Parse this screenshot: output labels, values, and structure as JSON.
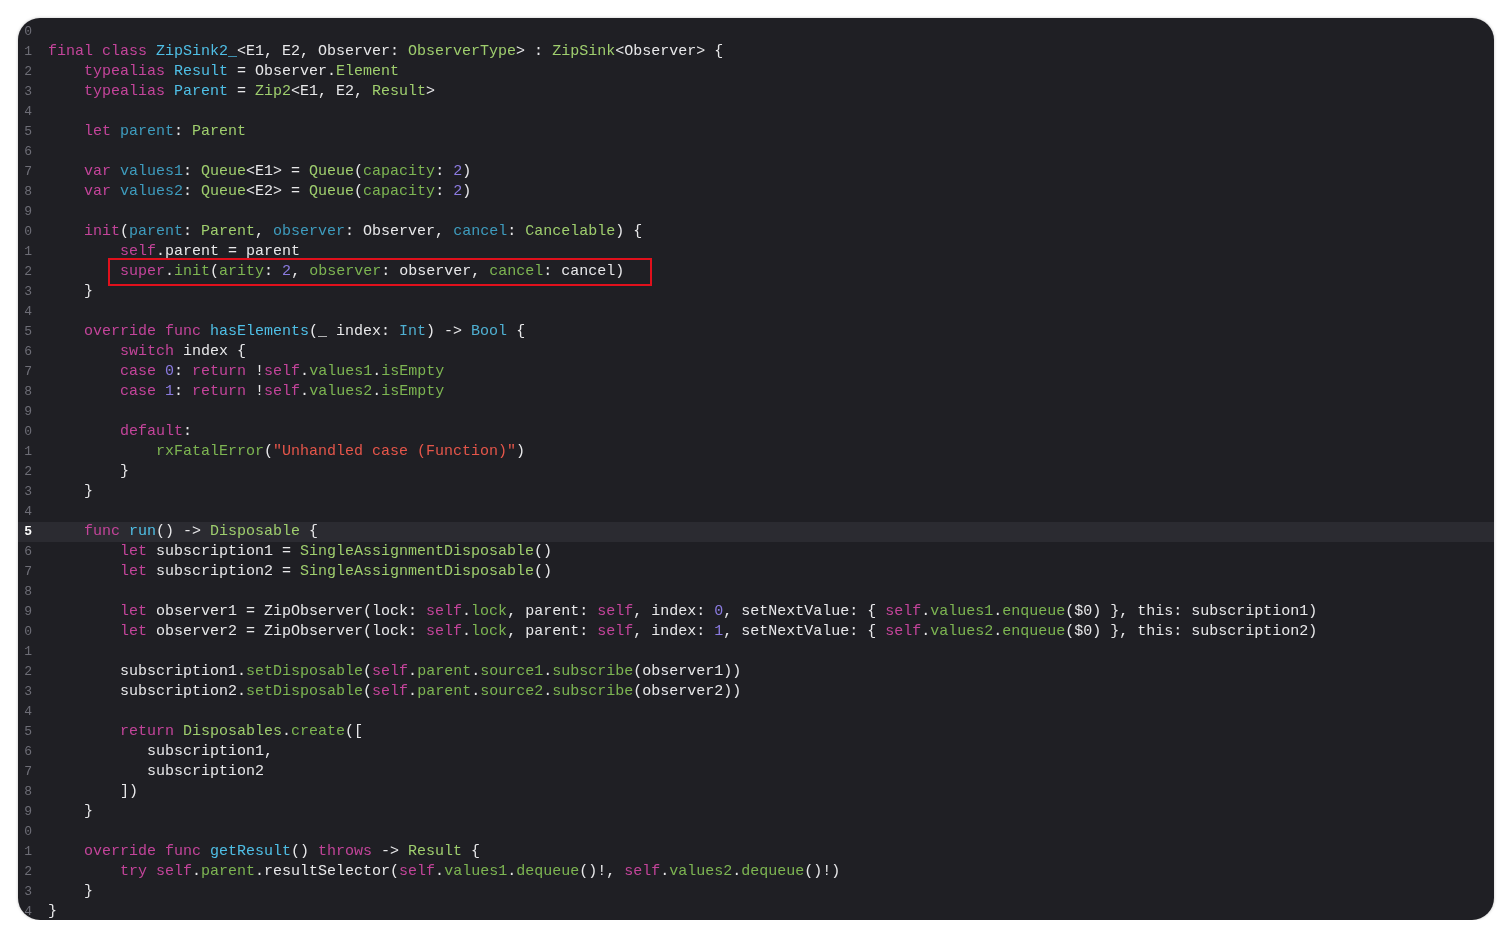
{
  "editor": {
    "lines": [
      {
        "n": "0",
        "current": false,
        "boxed": false
      },
      {
        "n": "1",
        "current": false,
        "boxed": false,
        "tokens": [
          {
            "kind": "kw",
            "text": "final class "
          },
          {
            "kind": "decl",
            "text": "ZipSink2_"
          },
          {
            "kind": "plain",
            "text": "<E1, E2, Observer: "
          },
          {
            "kind": "type",
            "text": "ObserverType"
          },
          {
            "kind": "plain",
            "text": "> : "
          },
          {
            "kind": "type",
            "text": "ZipSink"
          },
          {
            "kind": "plain",
            "text": "<Observer> {"
          }
        ]
      },
      {
        "n": "2",
        "current": false,
        "boxed": false,
        "tokens": [
          {
            "kind": "kw",
            "text": "    typealias "
          },
          {
            "kind": "decl",
            "text": "Result"
          },
          {
            "kind": "plain",
            "text": " = Observer."
          },
          {
            "kind": "type",
            "text": "Element"
          }
        ]
      },
      {
        "n": "3",
        "current": false,
        "boxed": false,
        "tokens": [
          {
            "kind": "kw",
            "text": "    typealias "
          },
          {
            "kind": "decl",
            "text": "Parent"
          },
          {
            "kind": "plain",
            "text": " = "
          },
          {
            "kind": "type",
            "text": "Zip2"
          },
          {
            "kind": "plain",
            "text": "<E1, E2, "
          },
          {
            "kind": "type",
            "text": "Result"
          },
          {
            "kind": "plain",
            "text": ">"
          }
        ]
      },
      {
        "n": "4",
        "current": false,
        "boxed": false
      },
      {
        "n": "5",
        "current": false,
        "boxed": false,
        "tokens": [
          {
            "kind": "kw",
            "text": "    let "
          },
          {
            "kind": "prop",
            "text": "parent"
          },
          {
            "kind": "plain",
            "text": ": "
          },
          {
            "kind": "type",
            "text": "Parent"
          }
        ]
      },
      {
        "n": "6",
        "current": false,
        "boxed": false
      },
      {
        "n": "7",
        "current": false,
        "boxed": false,
        "tokens": [
          {
            "kind": "kw",
            "text": "    var "
          },
          {
            "kind": "prop",
            "text": "values1"
          },
          {
            "kind": "plain",
            "text": ": "
          },
          {
            "kind": "type",
            "text": "Queue"
          },
          {
            "kind": "plain",
            "text": "<E1> = "
          },
          {
            "kind": "type",
            "text": "Queue"
          },
          {
            "kind": "plain",
            "text": "("
          },
          {
            "kind": "member",
            "text": "capacity"
          },
          {
            "kind": "plain",
            "text": ": "
          },
          {
            "kind": "num",
            "text": "2"
          },
          {
            "kind": "plain",
            "text": ")"
          }
        ]
      },
      {
        "n": "8",
        "current": false,
        "boxed": false,
        "tokens": [
          {
            "kind": "kw",
            "text": "    var "
          },
          {
            "kind": "prop",
            "text": "values2"
          },
          {
            "kind": "plain",
            "text": ": "
          },
          {
            "kind": "type",
            "text": "Queue"
          },
          {
            "kind": "plain",
            "text": "<E2> = "
          },
          {
            "kind": "type",
            "text": "Queue"
          },
          {
            "kind": "plain",
            "text": "("
          },
          {
            "kind": "member",
            "text": "capacity"
          },
          {
            "kind": "plain",
            "text": ": "
          },
          {
            "kind": "num",
            "text": "2"
          },
          {
            "kind": "plain",
            "text": ")"
          }
        ]
      },
      {
        "n": "9",
        "current": false,
        "boxed": false
      },
      {
        "n": "0",
        "current": false,
        "boxed": false,
        "tokens": [
          {
            "kind": "kw",
            "text": "    init"
          },
          {
            "kind": "plain",
            "text": "("
          },
          {
            "kind": "prop",
            "text": "parent"
          },
          {
            "kind": "plain",
            "text": ": "
          },
          {
            "kind": "type",
            "text": "Parent"
          },
          {
            "kind": "plain",
            "text": ", "
          },
          {
            "kind": "prop",
            "text": "observer"
          },
          {
            "kind": "plain",
            "text": ": Observer, "
          },
          {
            "kind": "prop",
            "text": "cancel"
          },
          {
            "kind": "plain",
            "text": ": "
          },
          {
            "kind": "type",
            "text": "Cancelable"
          },
          {
            "kind": "plain",
            "text": ") {"
          }
        ]
      },
      {
        "n": "1",
        "current": false,
        "boxed": false,
        "tokens": [
          {
            "kind": "kw",
            "text": "        self"
          },
          {
            "kind": "plain",
            "text": ".parent = parent"
          }
        ]
      },
      {
        "n": "2",
        "current": false,
        "boxed": true,
        "tokens": [
          {
            "kind": "kw",
            "text": "        super"
          },
          {
            "kind": "plain",
            "text": "."
          },
          {
            "kind": "member",
            "text": "init"
          },
          {
            "kind": "plain",
            "text": "("
          },
          {
            "kind": "member",
            "text": "arity"
          },
          {
            "kind": "plain",
            "text": ": "
          },
          {
            "kind": "num",
            "text": "2"
          },
          {
            "kind": "plain",
            "text": ", "
          },
          {
            "kind": "member",
            "text": "observer"
          },
          {
            "kind": "plain",
            "text": ": observer, "
          },
          {
            "kind": "member",
            "text": "cancel"
          },
          {
            "kind": "plain",
            "text": ": cancel)"
          }
        ]
      },
      {
        "n": "3",
        "current": false,
        "boxed": false,
        "tokens": [
          {
            "kind": "plain",
            "text": "    }"
          }
        ]
      },
      {
        "n": "4",
        "current": false,
        "boxed": false
      },
      {
        "n": "5",
        "current": false,
        "boxed": false,
        "tokens": [
          {
            "kind": "kw",
            "text": "    override func "
          },
          {
            "kind": "decl",
            "text": "hasElements"
          },
          {
            "kind": "plain",
            "text": "(_ index: "
          },
          {
            "kind": "sys",
            "text": "Int"
          },
          {
            "kind": "plain",
            "text": ") -> "
          },
          {
            "kind": "sys",
            "text": "Bool"
          },
          {
            "kind": "plain",
            "text": " {"
          }
        ]
      },
      {
        "n": "6",
        "current": false,
        "boxed": false,
        "tokens": [
          {
            "kind": "kw",
            "text": "        switch"
          },
          {
            "kind": "plain",
            "text": " index {"
          }
        ]
      },
      {
        "n": "7",
        "current": false,
        "boxed": false,
        "tokens": [
          {
            "kind": "kw",
            "text": "        case "
          },
          {
            "kind": "num",
            "text": "0"
          },
          {
            "kind": "plain",
            "text": ": "
          },
          {
            "kind": "kw",
            "text": "return"
          },
          {
            "kind": "plain",
            "text": " !"
          },
          {
            "kind": "kw",
            "text": "self"
          },
          {
            "kind": "plain",
            "text": "."
          },
          {
            "kind": "member",
            "text": "values1"
          },
          {
            "kind": "plain",
            "text": "."
          },
          {
            "kind": "member",
            "text": "isEmpty"
          }
        ]
      },
      {
        "n": "8",
        "current": false,
        "boxed": false,
        "tokens": [
          {
            "kind": "kw",
            "text": "        case "
          },
          {
            "kind": "num",
            "text": "1"
          },
          {
            "kind": "plain",
            "text": ": "
          },
          {
            "kind": "kw",
            "text": "return"
          },
          {
            "kind": "plain",
            "text": " !"
          },
          {
            "kind": "kw",
            "text": "self"
          },
          {
            "kind": "plain",
            "text": "."
          },
          {
            "kind": "member",
            "text": "values2"
          },
          {
            "kind": "plain",
            "text": "."
          },
          {
            "kind": "member",
            "text": "isEmpty"
          }
        ]
      },
      {
        "n": "9",
        "current": false,
        "boxed": false
      },
      {
        "n": "0",
        "current": false,
        "boxed": false,
        "tokens": [
          {
            "kind": "kw",
            "text": "        default"
          },
          {
            "kind": "plain",
            "text": ":"
          }
        ]
      },
      {
        "n": "1",
        "current": false,
        "boxed": false,
        "tokens": [
          {
            "kind": "member",
            "text": "            rxFatalError"
          },
          {
            "kind": "plain",
            "text": "("
          },
          {
            "kind": "str",
            "text": "\"Unhandled case (Function)\""
          },
          {
            "kind": "plain",
            "text": ")"
          }
        ]
      },
      {
        "n": "2",
        "current": false,
        "boxed": false,
        "tokens": [
          {
            "kind": "plain",
            "text": "        }"
          }
        ]
      },
      {
        "n": "3",
        "current": false,
        "boxed": false,
        "tokens": [
          {
            "kind": "plain",
            "text": "    }"
          }
        ]
      },
      {
        "n": "4",
        "current": false,
        "boxed": false
      },
      {
        "n": "5",
        "current": true,
        "boxed": false,
        "tokens": [
          {
            "kind": "kw",
            "text": "    func "
          },
          {
            "kind": "decl",
            "text": "run"
          },
          {
            "kind": "plain",
            "text": "() -> "
          },
          {
            "kind": "type",
            "text": "Disposable"
          },
          {
            "kind": "plain",
            "text": " {"
          }
        ]
      },
      {
        "n": "6",
        "current": false,
        "boxed": false,
        "tokens": [
          {
            "kind": "kw",
            "text": "        let "
          },
          {
            "kind": "plain",
            "text": "subscription1 = "
          },
          {
            "kind": "type",
            "text": "SingleAssignmentDisposable"
          },
          {
            "kind": "plain",
            "text": "()"
          }
        ]
      },
      {
        "n": "7",
        "current": false,
        "boxed": false,
        "tokens": [
          {
            "kind": "kw",
            "text": "        let "
          },
          {
            "kind": "plain",
            "text": "subscription2 = "
          },
          {
            "kind": "type",
            "text": "SingleAssignmentDisposable"
          },
          {
            "kind": "plain",
            "text": "()"
          }
        ]
      },
      {
        "n": "8",
        "current": false,
        "boxed": false
      },
      {
        "n": "9",
        "current": false,
        "boxed": false,
        "tokens": [
          {
            "kind": "kw",
            "text": "        let "
          },
          {
            "kind": "plain",
            "text": "observer1 = ZipObserver(lock: "
          },
          {
            "kind": "kw",
            "text": "self"
          },
          {
            "kind": "plain",
            "text": "."
          },
          {
            "kind": "member",
            "text": "lock"
          },
          {
            "kind": "plain",
            "text": ", parent: "
          },
          {
            "kind": "kw",
            "text": "self"
          },
          {
            "kind": "plain",
            "text": ", index: "
          },
          {
            "kind": "num",
            "text": "0"
          },
          {
            "kind": "plain",
            "text": ", setNextValue: { "
          },
          {
            "kind": "kw",
            "text": "self"
          },
          {
            "kind": "plain",
            "text": "."
          },
          {
            "kind": "member",
            "text": "values1"
          },
          {
            "kind": "plain",
            "text": "."
          },
          {
            "kind": "member",
            "text": "enqueue"
          },
          {
            "kind": "plain",
            "text": "($0) }, this: subscription1)"
          }
        ]
      },
      {
        "n": "0",
        "current": false,
        "boxed": false,
        "tokens": [
          {
            "kind": "kw",
            "text": "        let "
          },
          {
            "kind": "plain",
            "text": "observer2 = ZipObserver(lock: "
          },
          {
            "kind": "kw",
            "text": "self"
          },
          {
            "kind": "plain",
            "text": "."
          },
          {
            "kind": "member",
            "text": "lock"
          },
          {
            "kind": "plain",
            "text": ", parent: "
          },
          {
            "kind": "kw",
            "text": "self"
          },
          {
            "kind": "plain",
            "text": ", index: "
          },
          {
            "kind": "num",
            "text": "1"
          },
          {
            "kind": "plain",
            "text": ", setNextValue: { "
          },
          {
            "kind": "kw",
            "text": "self"
          },
          {
            "kind": "plain",
            "text": "."
          },
          {
            "kind": "member",
            "text": "values2"
          },
          {
            "kind": "plain",
            "text": "."
          },
          {
            "kind": "member",
            "text": "enqueue"
          },
          {
            "kind": "plain",
            "text": "($0) }, this: subscription2)"
          }
        ]
      },
      {
        "n": "1",
        "current": false,
        "boxed": false
      },
      {
        "n": "2",
        "current": false,
        "boxed": false,
        "tokens": [
          {
            "kind": "plain",
            "text": "        subscription1."
          },
          {
            "kind": "member",
            "text": "setDisposable"
          },
          {
            "kind": "plain",
            "text": "("
          },
          {
            "kind": "kw",
            "text": "self"
          },
          {
            "kind": "plain",
            "text": "."
          },
          {
            "kind": "member",
            "text": "parent"
          },
          {
            "kind": "plain",
            "text": "."
          },
          {
            "kind": "member",
            "text": "source1"
          },
          {
            "kind": "plain",
            "text": "."
          },
          {
            "kind": "member",
            "text": "subscribe"
          },
          {
            "kind": "plain",
            "text": "(observer1))"
          }
        ]
      },
      {
        "n": "3",
        "current": false,
        "boxed": false,
        "tokens": [
          {
            "kind": "plain",
            "text": "        subscription2."
          },
          {
            "kind": "member",
            "text": "setDisposable"
          },
          {
            "kind": "plain",
            "text": "("
          },
          {
            "kind": "kw",
            "text": "self"
          },
          {
            "kind": "plain",
            "text": "."
          },
          {
            "kind": "member",
            "text": "parent"
          },
          {
            "kind": "plain",
            "text": "."
          },
          {
            "kind": "member",
            "text": "source2"
          },
          {
            "kind": "plain",
            "text": "."
          },
          {
            "kind": "member",
            "text": "subscribe"
          },
          {
            "kind": "plain",
            "text": "(observer2))"
          }
        ]
      },
      {
        "n": "4",
        "current": false,
        "boxed": false
      },
      {
        "n": "5",
        "current": false,
        "boxed": false,
        "tokens": [
          {
            "kind": "kw",
            "text": "        return "
          },
          {
            "kind": "type",
            "text": "Disposables"
          },
          {
            "kind": "plain",
            "text": "."
          },
          {
            "kind": "member",
            "text": "create"
          },
          {
            "kind": "plain",
            "text": "(["
          }
        ]
      },
      {
        "n": "6",
        "current": false,
        "boxed": false,
        "tokens": [
          {
            "kind": "plain",
            "text": "           subscription1,"
          }
        ]
      },
      {
        "n": "7",
        "current": false,
        "boxed": false,
        "tokens": [
          {
            "kind": "plain",
            "text": "           subscription2"
          }
        ]
      },
      {
        "n": "8",
        "current": false,
        "boxed": false,
        "tokens": [
          {
            "kind": "plain",
            "text": "        ])"
          }
        ]
      },
      {
        "n": "9",
        "current": false,
        "boxed": false,
        "tokens": [
          {
            "kind": "plain",
            "text": "    }"
          }
        ]
      },
      {
        "n": "0",
        "current": false,
        "boxed": false
      },
      {
        "n": "1",
        "current": false,
        "boxed": false,
        "tokens": [
          {
            "kind": "kw",
            "text": "    override func "
          },
          {
            "kind": "decl",
            "text": "getResult"
          },
          {
            "kind": "plain",
            "text": "() "
          },
          {
            "kind": "kw",
            "text": "throws"
          },
          {
            "kind": "plain",
            "text": " -> "
          },
          {
            "kind": "type",
            "text": "Result"
          },
          {
            "kind": "plain",
            "text": " {"
          }
        ]
      },
      {
        "n": "2",
        "current": false,
        "boxed": false,
        "tokens": [
          {
            "kind": "kw",
            "text": "        try self"
          },
          {
            "kind": "plain",
            "text": "."
          },
          {
            "kind": "member",
            "text": "parent"
          },
          {
            "kind": "plain",
            "text": ".resultSelector("
          },
          {
            "kind": "kw",
            "text": "self"
          },
          {
            "kind": "plain",
            "text": "."
          },
          {
            "kind": "member",
            "text": "values1"
          },
          {
            "kind": "plain",
            "text": "."
          },
          {
            "kind": "member",
            "text": "dequeue"
          },
          {
            "kind": "plain",
            "text": "()!, "
          },
          {
            "kind": "kw",
            "text": "self"
          },
          {
            "kind": "plain",
            "text": "."
          },
          {
            "kind": "member",
            "text": "values2"
          },
          {
            "kind": "plain",
            "text": "."
          },
          {
            "kind": "member",
            "text": "dequeue"
          },
          {
            "kind": "plain",
            "text": "()!)"
          }
        ]
      },
      {
        "n": "3",
        "current": false,
        "boxed": false,
        "tokens": [
          {
            "kind": "plain",
            "text": "    }"
          }
        ]
      },
      {
        "n": "4",
        "current": false,
        "boxed": false,
        "tokens": [
          {
            "kind": "plain",
            "text": "}"
          }
        ]
      }
    ]
  }
}
